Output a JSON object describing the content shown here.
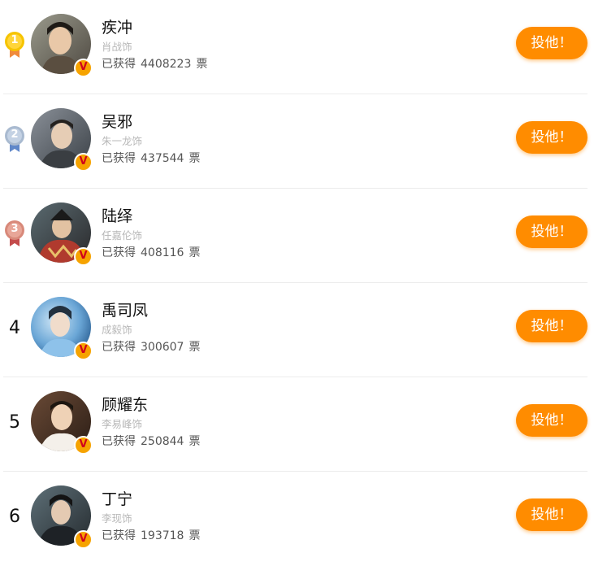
{
  "colors": {
    "accent": "#ff8c00",
    "gold": "#f6c400",
    "silver": "#a9bad0",
    "bronze": "#d8897a",
    "badge": "#f6a300",
    "badge_mark": "#d0021b"
  },
  "icons": {
    "medal_gold": "medal-gold-icon",
    "medal_silver": "medal-silver-icon",
    "medal_bronze": "medal-bronze-icon",
    "verified": "verified-v-icon"
  },
  "entries": [
    {
      "rank": "1",
      "name": "疾冲",
      "actor": "肖战饰",
      "votes_prefix": "已获得",
      "votes": "4408223",
      "votes_suffix": "票",
      "verified_mark": "V",
      "button": "投他！"
    },
    {
      "rank": "2",
      "name": "吴邪",
      "actor": "朱一龙饰",
      "votes_prefix": "已获得",
      "votes": "437544",
      "votes_suffix": "票",
      "verified_mark": "V",
      "button": "投他！"
    },
    {
      "rank": "3",
      "name": "陆绎",
      "actor": "任嘉伦饰",
      "votes_prefix": "已获得",
      "votes": "408116",
      "votes_suffix": "票",
      "verified_mark": "V",
      "button": "投他！"
    },
    {
      "rank": "4",
      "name": "禹司凤",
      "actor": "成毅饰",
      "votes_prefix": "已获得",
      "votes": "300607",
      "votes_suffix": "票",
      "verified_mark": "V",
      "button": "投他！"
    },
    {
      "rank": "5",
      "name": "顾耀东",
      "actor": "李易峰饰",
      "votes_prefix": "已获得",
      "votes": "250844",
      "votes_suffix": "票",
      "verified_mark": "V",
      "button": "投他！"
    },
    {
      "rank": "6",
      "name": "丁宁",
      "actor": "李现饰",
      "votes_prefix": "已获得",
      "votes": "193718",
      "votes_suffix": "票",
      "verified_mark": "V",
      "button": "投他！"
    }
  ]
}
